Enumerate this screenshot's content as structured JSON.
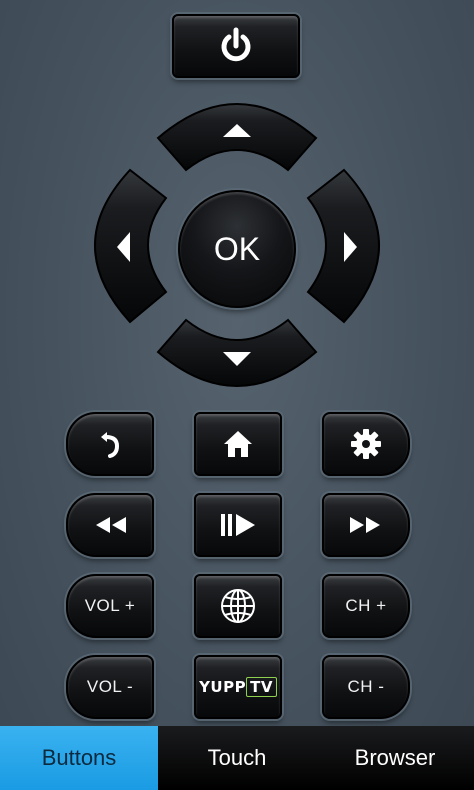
{
  "remote": {
    "power_icon": "power-icon",
    "ok_label": "OK",
    "up_icon": "arrow-up-icon",
    "down_icon": "arrow-down-icon",
    "left_icon": "arrow-left-icon",
    "right_icon": "arrow-right-icon",
    "back_icon": "back-icon",
    "home_icon": "home-icon",
    "settings_icon": "gear-icon",
    "rewind_icon": "rewind-icon",
    "play_pause_icon": "play-pause-icon",
    "fast_forward_icon": "fast-forward-icon",
    "vol_up_label": "VOL +",
    "vol_down_label": "VOL -",
    "ch_up_label": "CH +",
    "ch_down_label": "CH -",
    "web_icon": "globe-icon",
    "yupp_label_a": "YUPP",
    "yupp_label_b": "TV"
  },
  "tabs": [
    {
      "label": "Buttons",
      "active": true
    },
    {
      "label": "Touch",
      "active": false
    },
    {
      "label": "Browser",
      "active": false
    }
  ],
  "colors": {
    "background": "#46535f",
    "active_tab": "#1a9be3",
    "yupp_accent": "#8fd14f"
  }
}
